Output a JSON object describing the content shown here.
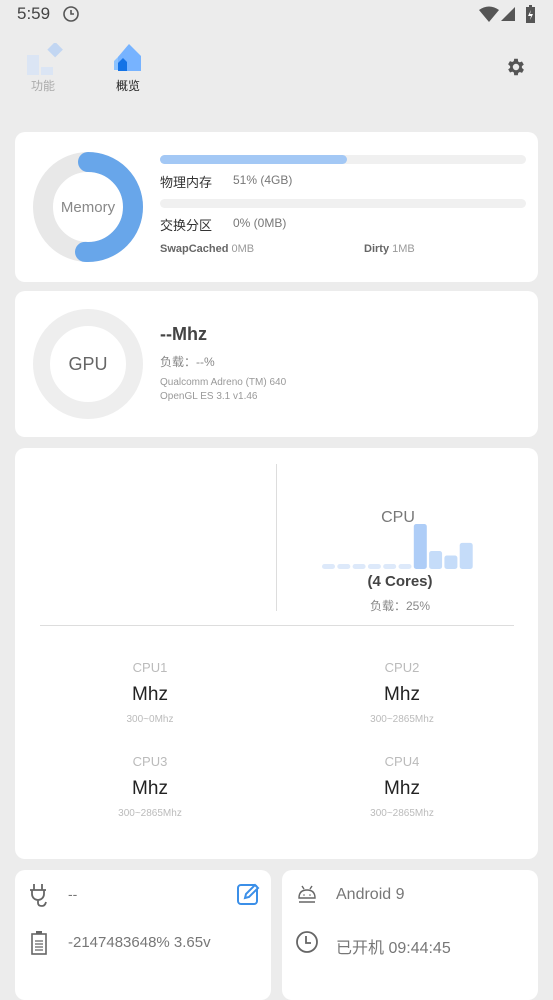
{
  "status_bar": {
    "time": "5:59",
    "icons": [
      "alarm-clock-icon",
      "wifi-icon",
      "cellular-signal-icon",
      "battery-charging-icon"
    ]
  },
  "nav": {
    "tabs": [
      {
        "label": "功能",
        "icon": "grid-icon",
        "active": false
      },
      {
        "label": "概览",
        "icon": "home-icon",
        "active": true
      }
    ],
    "settings_icon": "gear-icon"
  },
  "memory": {
    "ring_label": "Memory",
    "physical": {
      "label": "物理内存",
      "value": "51% (4GB)",
      "percent": 51
    },
    "swap": {
      "label": "交换分区",
      "value": "0% (0MB)",
      "percent": 0
    },
    "swapcached": {
      "label": "SwapCached",
      "value": "0MB"
    },
    "dirty": {
      "label": "Dirty",
      "value": "1MB"
    },
    "accent": "#68a6ea"
  },
  "gpu": {
    "ring_label": "GPU",
    "freq": "--Mhz",
    "load": "负载：--%",
    "renderer": "Qualcomm Adreno (TM) 640",
    "opengl": "OpenGL ES 3.1 v1.46"
  },
  "cpu": {
    "title": "CPU",
    "cores_label": "(4 Cores)",
    "load": "负载：25%",
    "history": [
      2,
      2,
      2,
      2,
      2,
      2,
      100,
      40,
      30,
      58
    ],
    "cores": [
      {
        "name": "CPU1",
        "freq": "Mhz",
        "range": "300~0Mhz"
      },
      {
        "name": "CPU2",
        "freq": "Mhz",
        "range": "300~2865Mhz"
      },
      {
        "name": "CPU3",
        "freq": "Mhz",
        "range": "300~2865Mhz"
      },
      {
        "name": "CPU4",
        "freq": "Mhz",
        "range": "300~2865Mhz"
      }
    ]
  },
  "power": {
    "charger": "--",
    "battery": "-2147483648%  3.65v",
    "edit_icon": "edit-icon"
  },
  "system": {
    "android": "Android 9",
    "uptime": "已开机  09:44:45"
  }
}
